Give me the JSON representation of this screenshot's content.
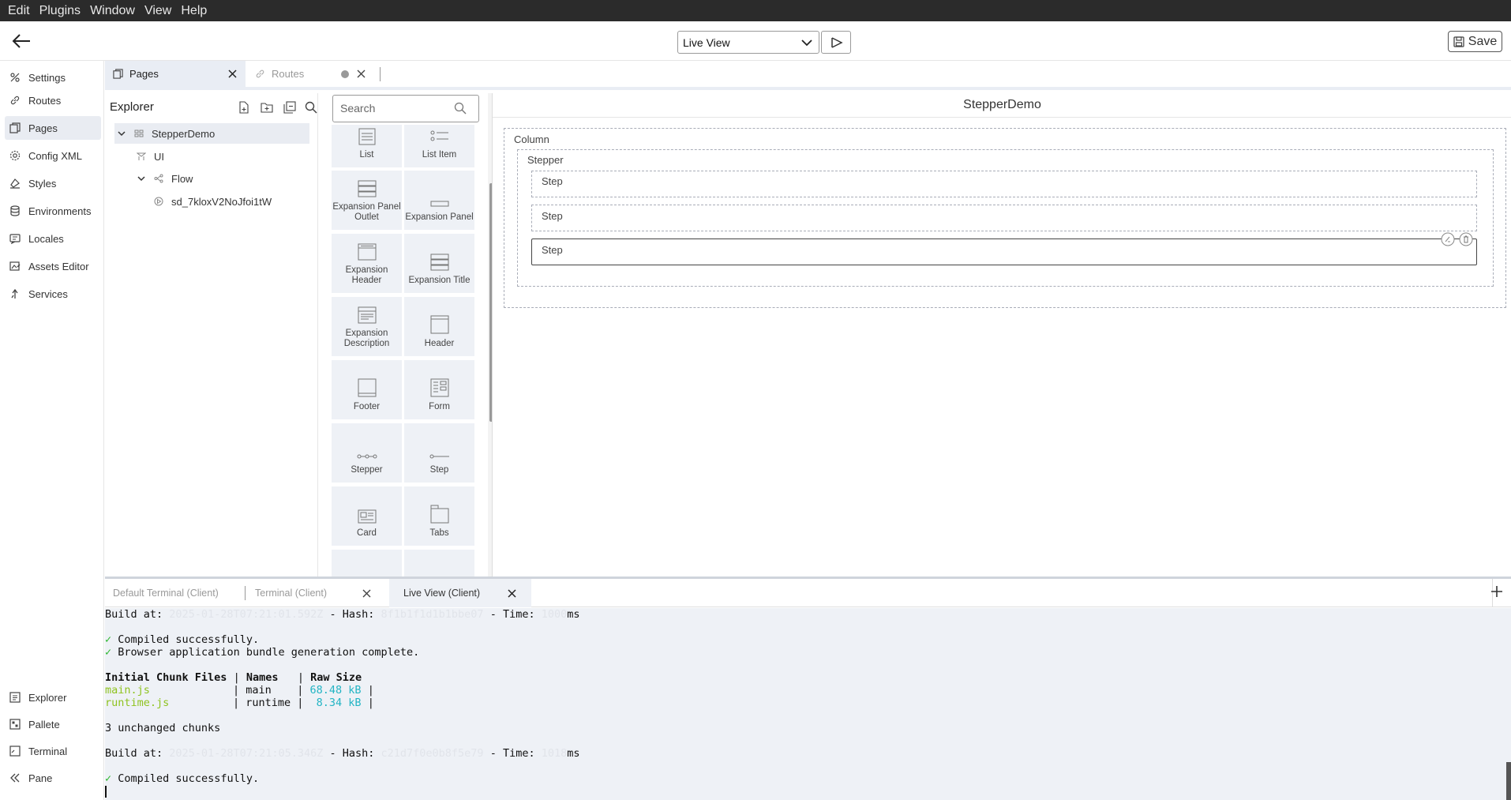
{
  "menubar": {
    "items": [
      "Edit",
      "Plugins",
      "Window",
      "View",
      "Help"
    ]
  },
  "toolbar": {
    "view_select_value": "Live View",
    "save_label": "Save"
  },
  "leftnav": {
    "items": [
      {
        "label": "Settings",
        "icon": "settings-icon"
      },
      {
        "label": "Routes",
        "icon": "link-icon"
      },
      {
        "label": "Pages",
        "icon": "pages-icon",
        "active": true
      },
      {
        "label": "Config XML",
        "icon": "gear-icon"
      },
      {
        "label": "Styles",
        "icon": "brush-icon"
      },
      {
        "label": "Environments",
        "icon": "database-icon"
      },
      {
        "label": "Locales",
        "icon": "translate-icon"
      },
      {
        "label": "Assets Editor",
        "icon": "image-edit-icon"
      },
      {
        "label": "Services",
        "icon": "services-icon"
      }
    ],
    "bottom_items": [
      {
        "label": "Explorer",
        "icon": "list-icon"
      },
      {
        "label": "Pallete",
        "icon": "grid-icon"
      },
      {
        "label": "Terminal",
        "icon": "terminal-icon"
      },
      {
        "label": "Pane",
        "icon": "collapse-icon"
      }
    ]
  },
  "editor_tabs": [
    {
      "label": "Pages",
      "active": true
    },
    {
      "label": "Routes",
      "active": false
    }
  ],
  "explorer": {
    "title": "Explorer",
    "tree": [
      {
        "label": "StepperDemo",
        "level": 0,
        "expanded": true
      },
      {
        "label": "UI",
        "level": 1
      },
      {
        "label": "Flow",
        "level": 1,
        "expanded": true
      },
      {
        "label": "sd_7kloxV2NoJfoi1tW",
        "level": 2
      }
    ]
  },
  "palette": {
    "search_placeholder": "Search",
    "items": [
      "List",
      "List Item",
      "Expansion Panel Outlet",
      "Expansion Panel",
      "Expansion Header",
      "Expansion Title",
      "Expansion Description",
      "Header",
      "Footer",
      "Form",
      "Stepper",
      "Step",
      "Card",
      "Tabs"
    ]
  },
  "canvas": {
    "title": "StepperDemo",
    "column_label": "Column",
    "stepper_label": "Stepper",
    "steps": [
      "Step",
      "Step",
      "Step"
    ]
  },
  "terminal_tabs": [
    {
      "label": "Default Terminal (Client)",
      "active": false
    },
    {
      "label": "Terminal (Client)",
      "active": false
    },
    {
      "label": "Live View (Client)",
      "active": true
    }
  ],
  "terminal": {
    "build1_prefix": "Build at: ",
    "build1_date": "2025-01-28T07:21:01.592Z",
    "hash_label": " - Hash: ",
    "build1_hash": "8f1b1f1d1b1bbe07",
    "time_label": " - Time: ",
    "build1_time": "1000",
    "ms": "ms",
    "compiled": "Compiled successfully.",
    "bundle": "Browser application bundle generation complete.",
    "table_header": [
      "Initial Chunk Files",
      "Names",
      "Raw Size"
    ],
    "rows": [
      {
        "file": "main.js",
        "name": "main",
        "size": "68.48 kB"
      },
      {
        "file": "runtime.js",
        "name": "runtime",
        "size": "8.34 kB"
      }
    ],
    "unchanged": "3 unchanged chunks",
    "build2_date": "2025-01-28T07:21:05.346Z",
    "build2_hash": "c21d7f0e0b8f5e79",
    "build2_time": "1018",
    "compiled2": "Compiled successfully."
  }
}
